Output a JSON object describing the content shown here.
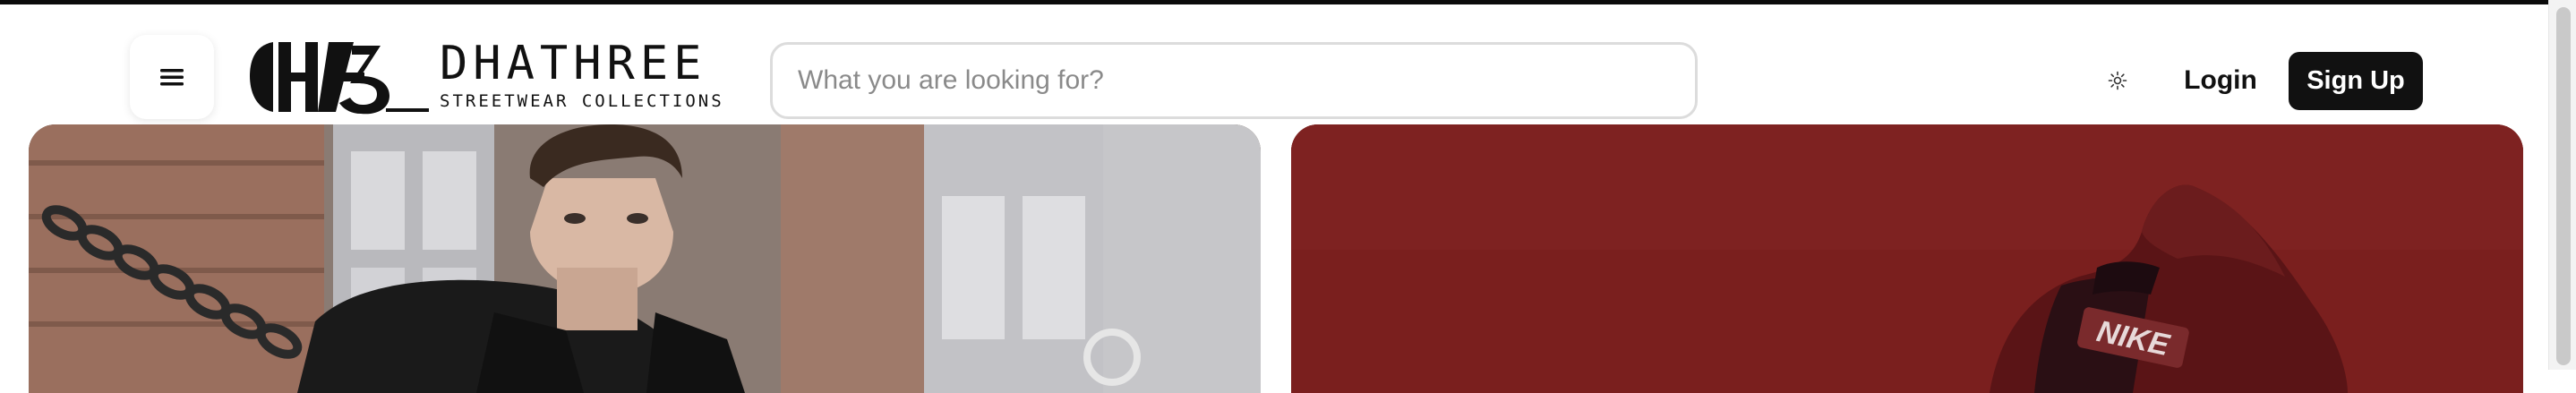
{
  "brand": {
    "title": "DHATHREE",
    "subtitle": "STREETWEAR COLLECTIONS",
    "logo_icon": "dh3-monogram-icon"
  },
  "header": {
    "menu_icon": "hamburger-menu-icon",
    "theme_icon": "sun-icon",
    "login_label": "Login",
    "signup_label": "Sign Up"
  },
  "search": {
    "placeholder": "What you are looking for?",
    "value": ""
  },
  "banners": {
    "right_brand_text": "NIKE"
  },
  "colors": {
    "primary": "#111111",
    "background": "#ffffff",
    "banner_red": "#7a1f1e"
  }
}
